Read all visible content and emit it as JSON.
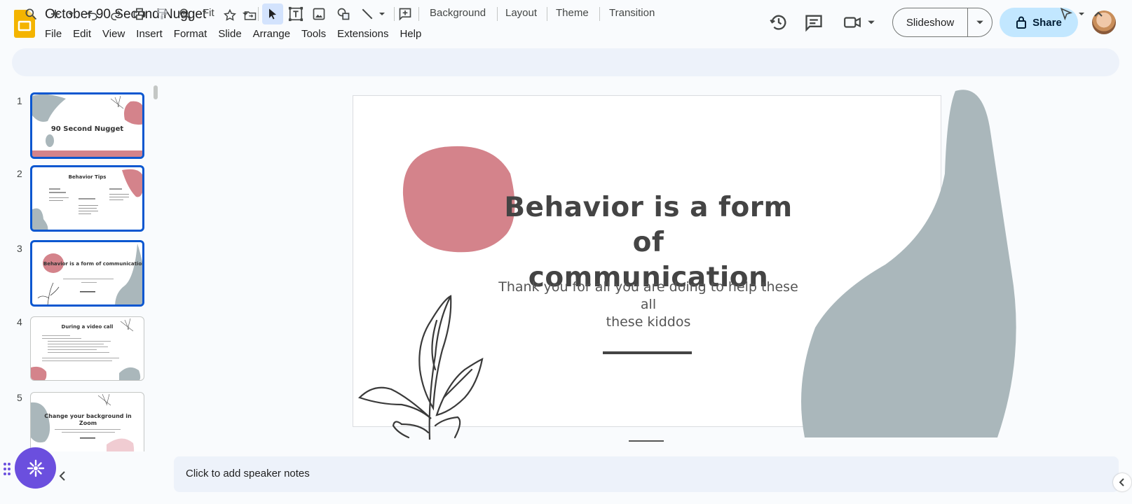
{
  "header": {
    "doc_title": "October 90 Second Nugget",
    "menu": [
      "File",
      "Edit",
      "View",
      "Insert",
      "Format",
      "Slide",
      "Arrange",
      "Tools",
      "Extensions",
      "Help"
    ],
    "slideshow_label": "Slideshow",
    "share_label": "Share"
  },
  "toolbar": {
    "zoom": "Fit",
    "background_label": "Background",
    "layout_label": "Layout",
    "theme_label": "Theme",
    "transition_label": "Transition"
  },
  "filmstrip": {
    "slides": [
      {
        "number": "1",
        "title": "90 Second Nugget"
      },
      {
        "number": "2",
        "title": "Behavior Tips"
      },
      {
        "number": "3",
        "title": "Behavior is a form of communication"
      },
      {
        "number": "4",
        "title": "During a video call"
      },
      {
        "number": "5",
        "title": "Change your background in Zoom"
      }
    ]
  },
  "slide": {
    "title_line1": "Behavior is a form of",
    "title_line2": "communication",
    "subtitle_line1": "Thank you for all you are doing to help these all",
    "subtitle_line2": "these kiddos"
  },
  "notes": {
    "placeholder": "Click to add speaker notes"
  },
  "colors": {
    "accent": "#0b57d0",
    "share_bg": "#c2e7ff",
    "pink_blob": "#d4838b",
    "gray_blob": "#aab7bb",
    "gemini": "#6b4fde"
  }
}
